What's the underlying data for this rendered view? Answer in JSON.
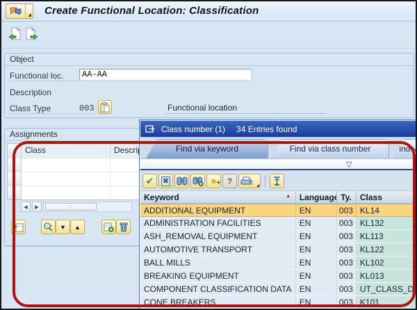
{
  "window": {
    "title": "Create Functional Location: Classification"
  },
  "icons": {
    "accept": "✔",
    "cancel": "✖",
    "star": "★",
    "help": "?",
    "dropdown": "▽",
    "sort_asc": "▲",
    "move_up": "▲",
    "move_down": "▼",
    "scroll_left": "◀",
    "scroll_right": "▶",
    "grip": ":::"
  },
  "object_section": {
    "title": "Object",
    "functional_loc": {
      "label": "Functional loc.",
      "value": "AA-AA"
    },
    "description": {
      "label": "Description"
    },
    "class_type": {
      "label": "Class Type",
      "value": "003",
      "text": "Functional location"
    }
  },
  "assignments": {
    "title": "Assignments",
    "columns": [
      "Class",
      "Description"
    ],
    "empty_row_count": 3
  },
  "popup": {
    "title": "Class number (1)",
    "entries_text": "34 Entries found",
    "tabs": [
      {
        "label": "Find via keyword",
        "active": true
      },
      {
        "label": "Find via class number",
        "active": false
      },
      {
        "label": "Find via",
        "active": false
      }
    ],
    "table": {
      "headers": [
        "Keyword",
        "Language",
        "Ty.",
        "Class"
      ],
      "rows": [
        {
          "keyword": "ADDITIONAL EQUIPMENT",
          "language": "EN",
          "ty": "003",
          "class": "KL14",
          "selected": true
        },
        {
          "keyword": "ADMINISTRATION FACILITIES",
          "language": "EN",
          "ty": "003",
          "class": "KL132",
          "selected": false
        },
        {
          "keyword": "ASH_REMOVAL EQUIPMENT",
          "language": "EN",
          "ty": "003",
          "class": "KL113",
          "selected": false
        },
        {
          "keyword": "AUTOMOTIVE TRANSPORT",
          "language": "EN",
          "ty": "003",
          "class": "KL122",
          "selected": false
        },
        {
          "keyword": "BALL MILLS",
          "language": "EN",
          "ty": "003",
          "class": "KL102",
          "selected": false
        },
        {
          "keyword": "BREAKING EQUIPMENT",
          "language": "EN",
          "ty": "003",
          "class": "KL013",
          "selected": false
        },
        {
          "keyword": "COMPONENT CLASSIFICATION DATA",
          "language": "EN",
          "ty": "003",
          "class": "UT_CLASS_DA",
          "selected": false
        },
        {
          "keyword": "CONE BREAKERS",
          "language": "EN",
          "ty": "003",
          "class": "K101",
          "selected": false
        }
      ]
    }
  },
  "annotation": {
    "color": "#ad1313"
  }
}
